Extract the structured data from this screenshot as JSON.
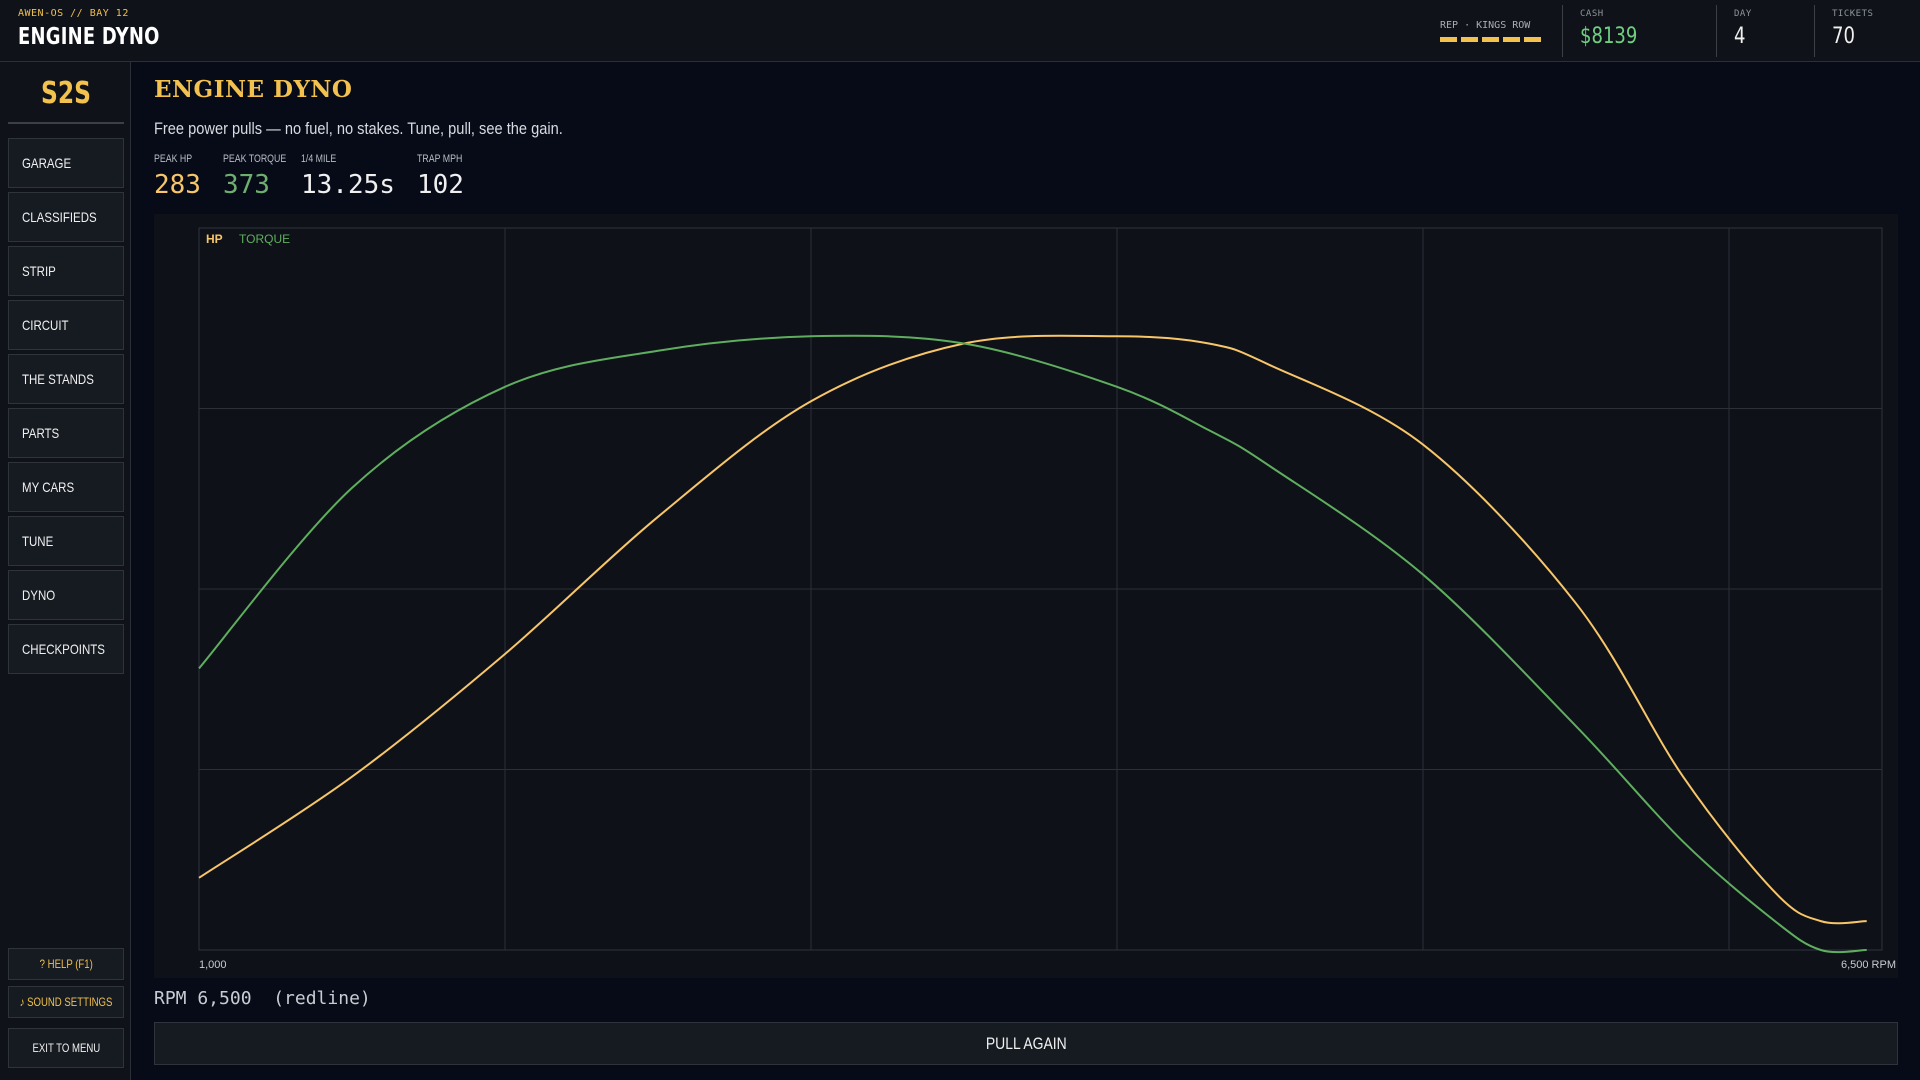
{
  "topbar": {
    "kicker": "AWEN-OS // BAY 12",
    "title": "ENGINE DYNO",
    "rep_label": "REP · KINGS ROW",
    "rep_level": 5,
    "cash_label": "CASH",
    "cash_value": "$8139",
    "day_label": "DAY",
    "day_value": "4",
    "tickets_label": "TICKETS",
    "tickets_value": "70"
  },
  "sidebar": {
    "logo": "S2S",
    "items": [
      {
        "label": "GARAGE"
      },
      {
        "label": "CLASSIFIEDS"
      },
      {
        "label": "STRIP"
      },
      {
        "label": "CIRCUIT"
      },
      {
        "label": "THE STANDS"
      },
      {
        "label": "PARTS"
      },
      {
        "label": "MY CARS"
      },
      {
        "label": "TUNE"
      },
      {
        "label": "DYNO"
      },
      {
        "label": "CHECKPOINTS"
      }
    ],
    "help": "? HELP (F1)",
    "sound": "♪ SOUND SETTINGS",
    "exit": "EXIT TO MENU"
  },
  "main": {
    "title": "ENGINE DYNO",
    "subtitle": "Free power pulls — no fuel, no stakes. Tune, pull, see the gain.",
    "metrics": [
      {
        "label": "PEAK HP",
        "value": "283"
      },
      {
        "label": "PEAK TORQUE",
        "value": "373"
      },
      {
        "label": "1/4 MILE",
        "value": "13.25s"
      },
      {
        "label": "TRAP MPH",
        "value": "102"
      }
    ],
    "rpm_readout": "RPM 6,500  (redline)",
    "pull_button": "PULL AGAIN"
  },
  "colors": {
    "accent": "#f2c14e",
    "cash": "#6fcf7f",
    "hp_line": "#f7c56a",
    "torque_line": "#5fae5f"
  },
  "chart_data": {
    "type": "line",
    "xlabel_min": "1,000",
    "xlabel_max": "6,500 RPM",
    "xlim": [
      1000,
      6500
    ],
    "ylim": [
      0,
      1
    ],
    "grid": true,
    "legend": "top-left",
    "series": [
      {
        "name": "HP",
        "x": [
          1000,
          1500,
          2000,
          2500,
          3000,
          3500,
          4000,
          4300,
          4500,
          5000,
          5500,
          5850,
          6150,
          6300,
          6450
        ],
        "values": [
          0.1,
          0.24,
          0.41,
          0.6,
          0.76,
          0.84,
          0.85,
          0.84,
          0.81,
          0.7,
          0.48,
          0.24,
          0.08,
          0.04,
          0.04
        ]
      },
      {
        "name": "TORQUE",
        "x": [
          1000,
          1500,
          2000,
          2500,
          3000,
          3500,
          4000,
          4300,
          4500,
          5000,
          5500,
          5850,
          6150,
          6300,
          6450
        ],
        "values": [
          0.39,
          0.64,
          0.78,
          0.83,
          0.85,
          0.84,
          0.78,
          0.72,
          0.67,
          0.52,
          0.31,
          0.15,
          0.04,
          0.0,
          0.0
        ]
      }
    ]
  }
}
